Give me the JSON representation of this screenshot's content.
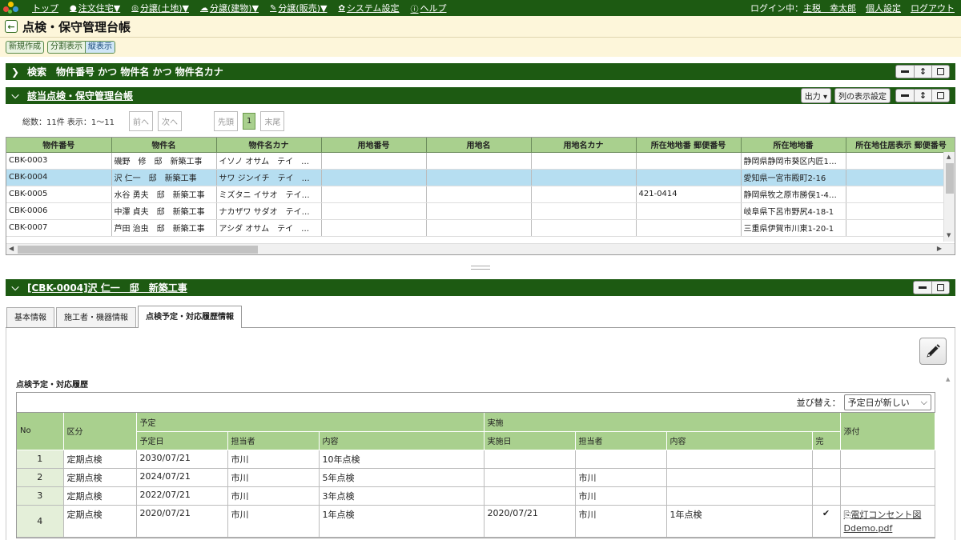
{
  "nav": {
    "items": [
      {
        "label": "トップ",
        "icon": "app-logo"
      },
      {
        "label": "注文住宅▼",
        "icon": "circle-icon",
        "glyph": "●"
      },
      {
        "label": "分譲(土地)▼",
        "icon": "target-icon",
        "glyph": "◎"
      },
      {
        "label": "分譲(建物)▼",
        "icon": "cloud-icon",
        "glyph": "☁"
      },
      {
        "label": "分譲(販売)▼",
        "icon": "pen-icon",
        "glyph": "✎"
      },
      {
        "label": "システム設定",
        "icon": "gear-icon",
        "glyph": "✿"
      },
      {
        "label": "ヘルプ",
        "icon": "info-icon",
        "glyph": "ⓘ"
      }
    ],
    "login_prefix": "ログイン中：",
    "login_user": "主税　幸太郎",
    "personal": "個人設定",
    "logout": "ログアウト"
  },
  "page": {
    "title": "点検・保守管理台帳",
    "new": "新規作成",
    "split": "分割表示",
    "zoom": "縦表示"
  },
  "search": {
    "title": "検索　物件番号 かつ 物件名 かつ 物件名カナ"
  },
  "list": {
    "title": "該当点検・保守管理台帳",
    "output": "出力 ▾",
    "colsetting": "列の表示設定",
    "total": "総数：11件  表示：1～11",
    "prev": "前へ",
    "next": "次へ",
    "first": "先頭",
    "page": "1",
    "last": "末尾",
    "columns": [
      "物件番号",
      "物件名",
      "物件名カナ",
      "用地番号",
      "用地名",
      "用地名カナ",
      "所在地地番 郵便番号",
      "所在地地番",
      "所在地住居表示 郵便番号"
    ],
    "rows": [
      [
        "CBK-0003",
        "磯野　修　邸　新築工事",
        "イソノ オサム　テイ　…",
        "",
        "",
        "",
        "",
        "静岡県静岡市葵区内匠1…",
        ""
      ],
      [
        "CBK-0004",
        "沢 仁一　邸　新築工事",
        "サワ ジンイチ　テイ　…",
        "",
        "",
        "",
        "",
        "愛知県一宮市殿町2-16",
        ""
      ],
      [
        "CBK-0005",
        "水谷 勇夫　邸　新築工事",
        "ミズタニ イサオ　テイ…",
        "",
        "",
        "",
        "421-0414",
        "静岡県牧之原市勝俣1-4…",
        ""
      ],
      [
        "CBK-0006",
        "中澤 貞夫　邸　新築工事",
        "ナカザワ サダオ　テイ…",
        "",
        "",
        "",
        "",
        "岐阜県下呂市野尻4-18-1",
        ""
      ],
      [
        "CBK-0007",
        "芦田 治虫　邸　新築工事",
        "アシダ オサム　テイ　…",
        "",
        "",
        "",
        "",
        "三重県伊賀市川東1-20-1",
        ""
      ]
    ],
    "selected_index": 1
  },
  "detail": {
    "title": "[CBK-0004]沢 仁一　邸　新築工事",
    "tabs": [
      "基本情報",
      "施工者・機器情報",
      "点検予定・対応履歴情報"
    ],
    "active_tab": 2,
    "section_label": "点検予定・対応履歴",
    "sort_label": "並び替え：",
    "sort_value": "予定日が新しい",
    "headers": {
      "no": "No",
      "kubun": "区分",
      "yotei": "予定",
      "jisshi": "実施",
      "attach": "添付",
      "yotei_date": "予定日",
      "yotei_person": "担当者",
      "yotei_content": "内容",
      "jisshi_date": "実施日",
      "jisshi_person": "担当者",
      "jisshi_content": "内容",
      "done": "完"
    },
    "rows": [
      {
        "no": "1",
        "kubun": "定期点検",
        "yotei_date": "2030/07/21",
        "yotei_person": "市川",
        "yotei_content": "10年点検",
        "jisshi_date": "",
        "jisshi_person": "",
        "jisshi_content": "",
        "done": "",
        "attach": ""
      },
      {
        "no": "2",
        "kubun": "定期点検",
        "yotei_date": "2024/07/21",
        "yotei_person": "市川",
        "yotei_content": "5年点検",
        "jisshi_date": "",
        "jisshi_person": "市川",
        "jisshi_content": "",
        "done": "",
        "attach": ""
      },
      {
        "no": "3",
        "kubun": "定期点検",
        "yotei_date": "2022/07/21",
        "yotei_person": "市川",
        "yotei_content": "3年点検",
        "jisshi_date": "",
        "jisshi_person": "市川",
        "jisshi_content": "",
        "done": "",
        "attach": ""
      },
      {
        "no": "4",
        "kubun": "定期点検",
        "yotei_date": "2020/07/21",
        "yotei_person": "市川",
        "yotei_content": "1年点検",
        "jisshi_date": "2020/07/21",
        "jisshi_person": "市川",
        "jisshi_content": "1年点検",
        "done": "✔",
        "attach": "電灯コンセント図Ddemo.pdf"
      }
    ]
  },
  "colors": {
    "nav_bg": "#1d5a12",
    "header_green": "#a9d08e",
    "selected_row": "#b6def1",
    "title_bg": "#fdf6da"
  }
}
